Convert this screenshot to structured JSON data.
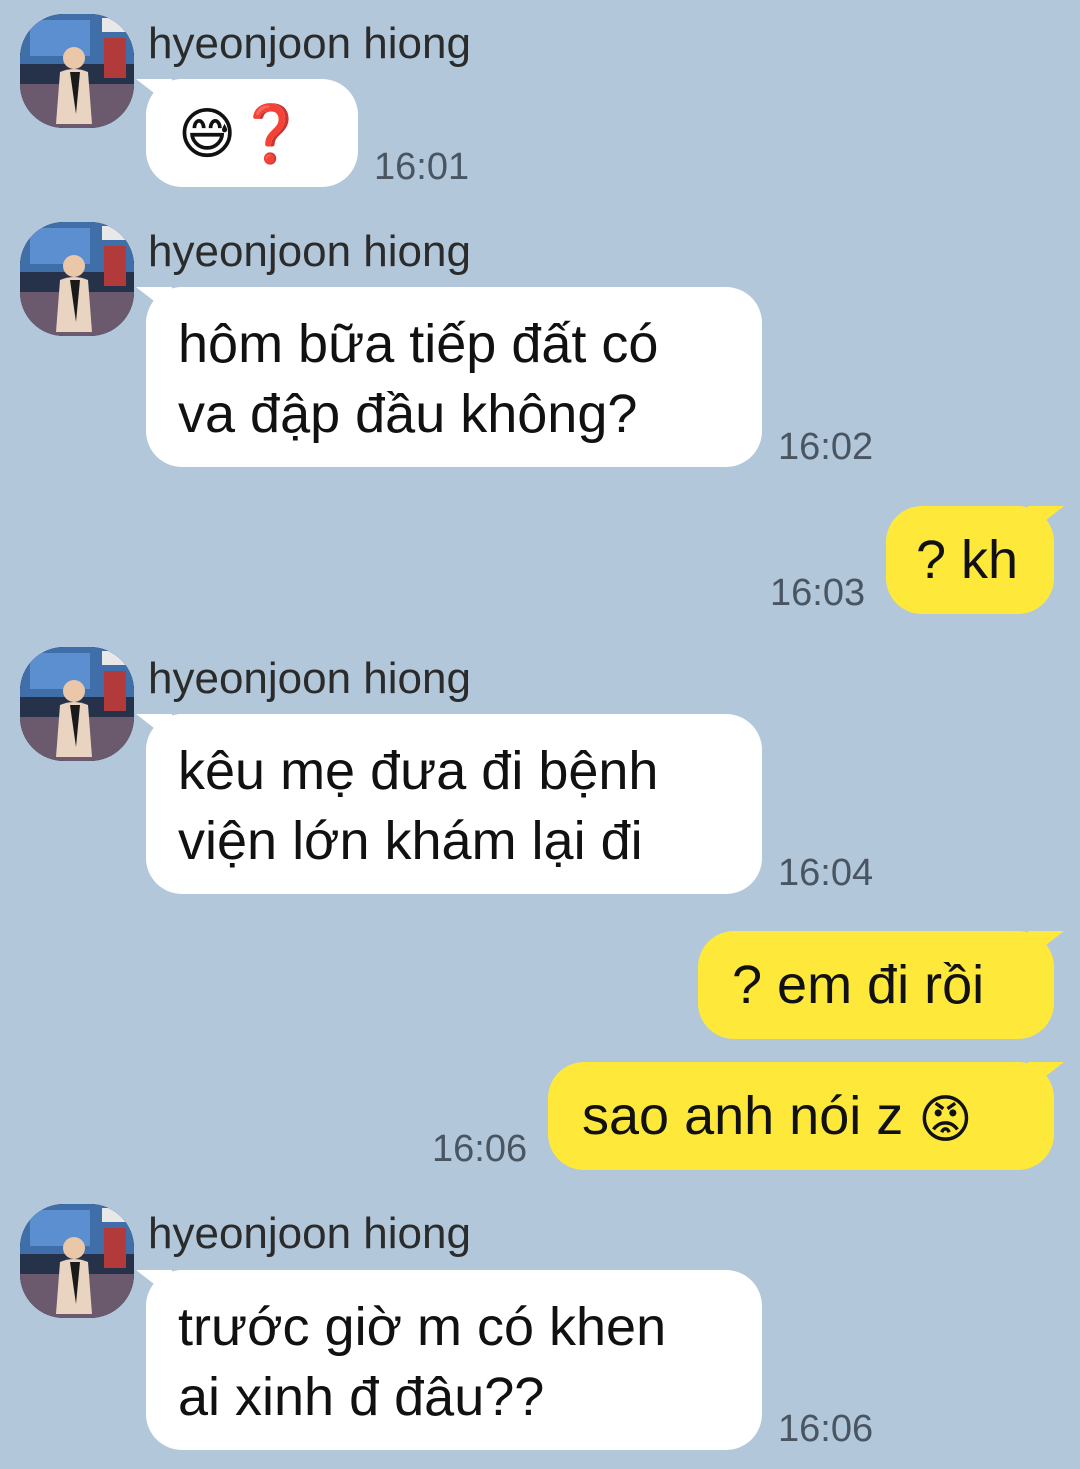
{
  "messages": [
    {
      "sender": "hyeonjoon hiong",
      "text": "😅❓",
      "time": "16:01"
    },
    {
      "sender": "hyeonjoon hiong",
      "line1": "hôm bữa tiếp đất có",
      "line2": "va đập đầu không?",
      "time": "16:02"
    },
    {
      "text": "? kh",
      "time": "16:03"
    },
    {
      "sender": "hyeonjoon hiong",
      "line1": "kêu mẹ đưa đi bệnh",
      "line2": "viện lớn khám lại đi",
      "time": "16:04"
    },
    {
      "text": "? em đi rồi"
    },
    {
      "text": "sao anh nói z ",
      "emoji": "😡",
      "time": "16:06"
    },
    {
      "sender": "hyeonjoon hiong",
      "line1": "trước giờ m có khen",
      "line2": "ai xinh đ đâu??",
      "time": "16:06"
    }
  ],
  "colors": {
    "background": "#b2c7da",
    "incoming_bubble": "#ffffff",
    "outgoing_bubble": "#fee93b"
  }
}
